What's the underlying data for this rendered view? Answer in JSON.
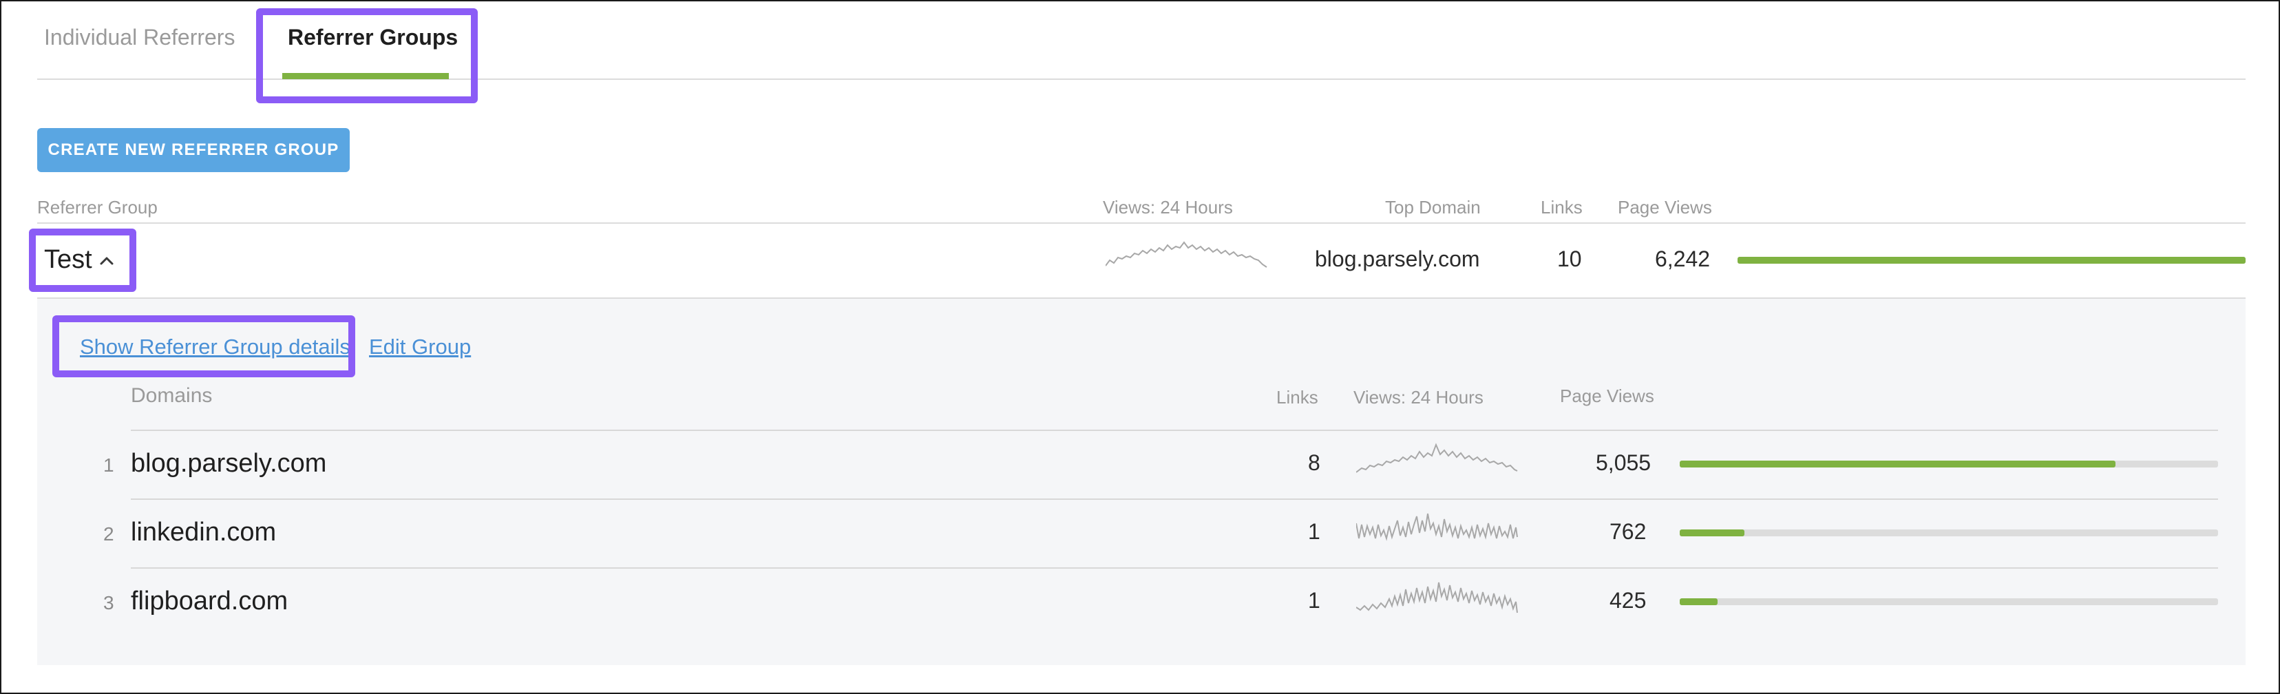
{
  "tabs": [
    {
      "label": "Individual Referrers",
      "active": false
    },
    {
      "label": "Referrer Groups",
      "active": true
    }
  ],
  "create_button": {
    "label": "CREATE NEW REFERRER GROUP"
  },
  "table": {
    "headers": {
      "group": "Referrer Group",
      "views": "Views: 24 Hours",
      "top_domain": "Top Domain",
      "links": "Links",
      "page_views": "Page Views"
    },
    "groups": [
      {
        "name": "Test",
        "expanded": true,
        "top_domain": "blog.parsely.com",
        "links": "10",
        "page_views": "6,242",
        "page_views_fraction": 1.0
      }
    ]
  },
  "details": {
    "show_details_link": "Show Referrer Group details",
    "edit_link": "Edit Group",
    "headers": {
      "domains": "Domains",
      "links": "Links",
      "views": "Views: 24 Hours",
      "page_views": "Page Views"
    },
    "rows": [
      {
        "rank": "1",
        "domain": "blog.parsely.com",
        "links": "8",
        "page_views": "5,055",
        "page_views_fraction": 0.81
      },
      {
        "rank": "2",
        "domain": "linkedin.com",
        "links": "1",
        "page_views": "762",
        "page_views_fraction": 0.12
      },
      {
        "rank": "3",
        "domain": "flipboard.com",
        "links": "1",
        "page_views": "425",
        "page_views_fraction": 0.07
      }
    ]
  },
  "colors": {
    "accent_green": "#7fb241",
    "button_blue": "#5aa6e2",
    "link_blue": "#4a90d6",
    "highlight_purple": "#8b5cf6",
    "panel_bg": "#f5f6f8"
  }
}
